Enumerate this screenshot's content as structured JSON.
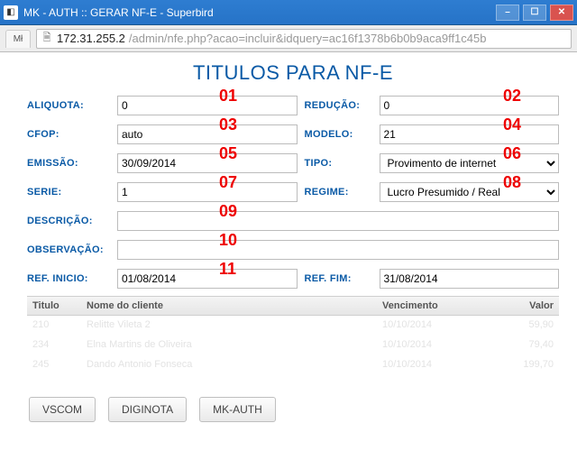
{
  "window": {
    "title": "MK - AUTH :: GERAR NF-E - Superbird",
    "tab_stub": "Mł"
  },
  "url": {
    "host": "172.31.255.2",
    "path": "/admin/nfe.php?acao=incluir&idquery=ac16f1378b6b0b9aca9ff1c45b"
  },
  "page": {
    "title": "TITULOS PARA NF-E"
  },
  "labels": {
    "aliquota": "ALIQUOTA:",
    "reducao": "REDUÇÃO:",
    "cfop": "CFOP:",
    "modelo": "MODELO:",
    "emissao": "EMISSÃO:",
    "tipo": "TIPO:",
    "serie": "SERIE:",
    "regime": "REGIME:",
    "descricao": "DESCRIÇÃO:",
    "observacao": "OBSERVAÇÃO:",
    "ref_inicio": "REF. INICIO:",
    "ref_fim": "REF. FIM:"
  },
  "values": {
    "aliquota": "0",
    "reducao": "0",
    "cfop": "auto",
    "modelo": "21",
    "emissao": "30/09/2014",
    "tipo": "Provimento de internet",
    "serie": "1",
    "regime": "Lucro Presumido / Real",
    "descricao": "",
    "observacao": "",
    "ref_inicio": "01/08/2014",
    "ref_fim": "31/08/2014"
  },
  "table": {
    "headers": {
      "titulo": "Titulo",
      "nome": "Nome do cliente",
      "venc": "Vencimento",
      "valor": "Valor"
    },
    "rows": [
      {
        "titulo": "210",
        "nome": "Relitte Vileta 2",
        "venc": "10/10/2014",
        "valor": "59,90"
      },
      {
        "titulo": "234",
        "nome": "Elna Martins de Oliveira",
        "venc": "10/10/2014",
        "valor": "79,40"
      },
      {
        "titulo": "245",
        "nome": "Dando Antonio Fonseca",
        "venc": "10/10/2014",
        "valor": "199,70"
      }
    ]
  },
  "buttons": {
    "vscom": "VSCOM",
    "diginota": "DIGINOTA",
    "mkauth": "MK-AUTH"
  },
  "marks": [
    "01",
    "02",
    "03",
    "04",
    "05",
    "06",
    "07",
    "08",
    "09",
    "10",
    "11"
  ]
}
